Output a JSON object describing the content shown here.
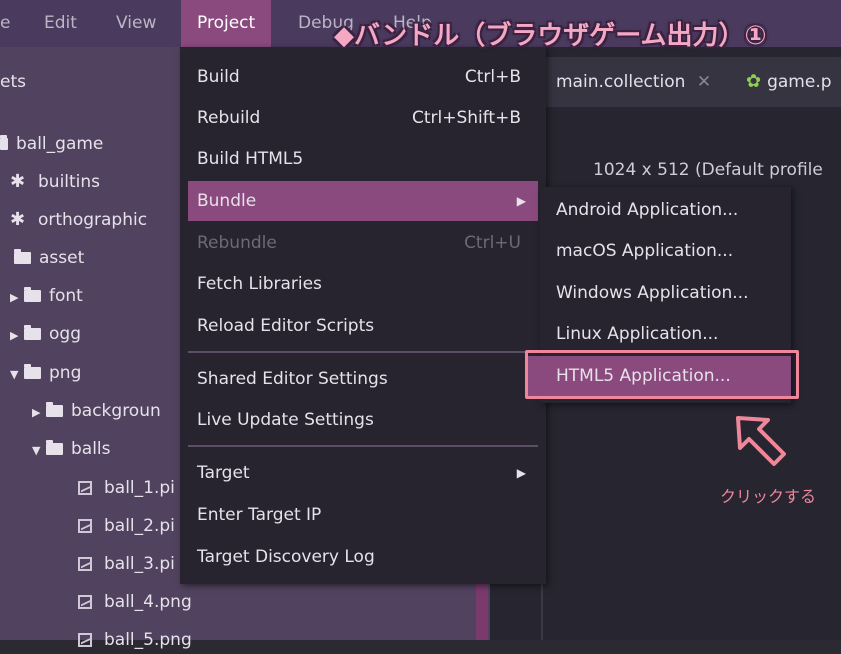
{
  "menubar": {
    "items": [
      "e",
      "Edit",
      "View",
      "Project",
      "Debug",
      "Help"
    ]
  },
  "banner": "◆バンドル（ブラウザゲーム出力）①",
  "tabs": [
    "main.collection",
    "game.p"
  ],
  "tab_close_glyph": "✕",
  "resolution": "1024 x 512 (Default profile",
  "assets": {
    "header": "ets",
    "tree": [
      {
        "label": "ball_game",
        "icon": "folder-icon"
      },
      {
        "label": "builtins",
        "icon": "puzzle-icon"
      },
      {
        "label": "orthographic",
        "icon": "puzzle-icon"
      },
      {
        "label": "asset",
        "icon": "folder-icon"
      },
      {
        "label": "font",
        "icon": "folder-icon"
      },
      {
        "label": "ogg",
        "icon": "folder-icon"
      },
      {
        "label": "png",
        "icon": "folder-icon"
      },
      {
        "label": "backgroun",
        "icon": "folder-icon"
      },
      {
        "label": "balls",
        "icon": "folder-icon"
      },
      {
        "label": "ball_1.pi",
        "icon": "image-icon"
      },
      {
        "label": "ball_2.pi",
        "icon": "image-icon"
      },
      {
        "label": "ball_3.pi",
        "icon": "image-icon"
      },
      {
        "label": "ball_4.png",
        "icon": "image-icon"
      },
      {
        "label": "ball_5.png",
        "icon": "image-icon"
      }
    ]
  },
  "project_menu": {
    "items": [
      {
        "label": "Build",
        "shortcut": "Ctrl+B"
      },
      {
        "label": "Rebuild",
        "shortcut": "Ctrl+Shift+B"
      },
      {
        "label": "Build HTML5",
        "shortcut": ""
      },
      {
        "label": "Bundle",
        "shortcut": ""
      },
      {
        "label": "Rebundle",
        "shortcut": "Ctrl+U"
      },
      {
        "label": "Fetch Libraries",
        "shortcut": ""
      },
      {
        "label": "Reload Editor Scripts",
        "shortcut": ""
      },
      {
        "label": "Shared Editor Settings",
        "shortcut": ""
      },
      {
        "label": "Live Update Settings",
        "shortcut": ""
      },
      {
        "label": "Target",
        "shortcut": ""
      },
      {
        "label": "Enter Target IP",
        "shortcut": ""
      },
      {
        "label": "Target Discovery Log",
        "shortcut": ""
      }
    ]
  },
  "bundle_submenu": {
    "items": [
      "Android Application...",
      "macOS Application...",
      "Windows Application...",
      "Linux Application...",
      "HTML5 Application..."
    ]
  },
  "annotation": {
    "click_note": "クリックする",
    "color": "#f0869a"
  },
  "colors": {
    "accent": "#8a4a7e",
    "menu_bg": "#27232f",
    "panel_bg": "#51435f"
  }
}
